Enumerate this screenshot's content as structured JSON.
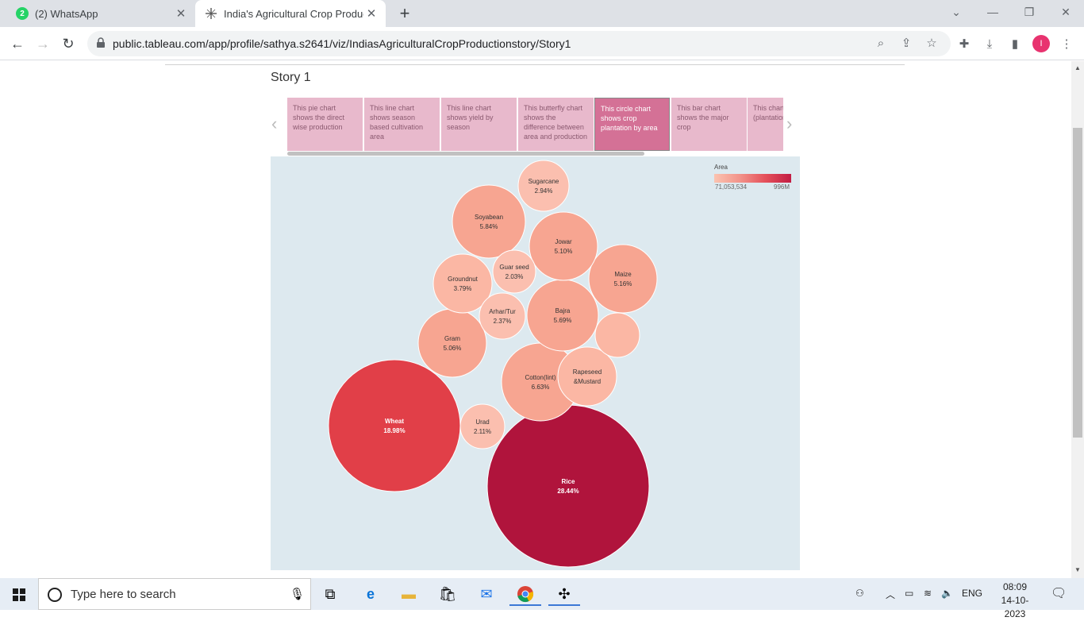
{
  "browser": {
    "tabs": [
      {
        "label": "(2) WhatsApp",
        "badge": "2"
      },
      {
        "label": "India's Agricultural Crop Product"
      }
    ],
    "url": "public.tableau.com/app/profile/sathya.s2641/viz/IndiasAgriculturalCropProductionstory/Story1",
    "avatar_letter": "I"
  },
  "story": {
    "title": "Story 1",
    "points": [
      "This pie chart shows the direct wise production",
      "This line chart shows season based cultivation area",
      "This line chart shows yield by season",
      "This butterfly chart shows the difference between area and production",
      "This circle chart shows crop plantation by area",
      "This bar chart shows the major crop",
      "This chart the crop (plantation count)"
    ],
    "active_index": 4
  },
  "legend": {
    "title": "Area",
    "min": "71,053,534",
    "max": "996M",
    "colors": [
      "#fbc3b0",
      "#c21d43"
    ]
  },
  "chart_data": {
    "type": "bubble",
    "measure": "Area",
    "bubbles": [
      {
        "name": "Rice",
        "label": "28.44%",
        "share": 28.44
      },
      {
        "name": "Wheat",
        "label": "18.98%",
        "share": 18.98
      },
      {
        "name": "Cotton(lint)",
        "label": "6.63%",
        "share": 6.63
      },
      {
        "name": "Soyabean",
        "label": "5.84%",
        "share": 5.84
      },
      {
        "name": "Bajra",
        "label": "5.69%",
        "share": 5.69
      },
      {
        "name": "Maize",
        "label": "5.16%",
        "share": 5.16
      },
      {
        "name": "Jowar",
        "label": "5.10%",
        "share": 5.1
      },
      {
        "name": "Gram",
        "label": "5.06%",
        "share": 5.06
      },
      {
        "name": "Rapeseed &Mustard",
        "label": "",
        "share": null
      },
      {
        "name": "Groundnut",
        "label": "3.79%",
        "share": 3.79
      },
      {
        "name": "",
        "label": "",
        "share": null
      },
      {
        "name": "Sugarcane",
        "label": "2.94%",
        "share": 2.94
      },
      {
        "name": "Arhar/Tur",
        "label": "2.37%",
        "share": 2.37
      },
      {
        "name": "Urad",
        "label": "2.11%",
        "share": 2.11
      },
      {
        "name": "Guar seed",
        "label": "2.03%",
        "share": 2.03
      }
    ]
  },
  "taskbar": {
    "search_placeholder": "Type here to search",
    "language": "ENG",
    "time": "08:09",
    "date": "14-10-2023"
  }
}
